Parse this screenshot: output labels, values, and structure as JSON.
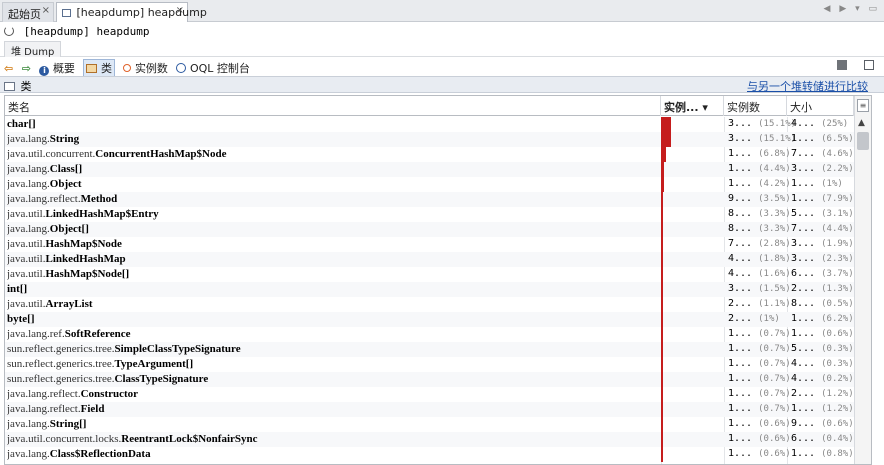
{
  "tabs": [
    {
      "label": "起始页",
      "close": "×"
    },
    {
      "label": "[heapdump] heapdump",
      "close": "×"
    }
  ],
  "nav_arrows": "◀ ▶ ▾ ▭",
  "title": "[heapdump] heapdump",
  "subtab": "堆 Dump",
  "toolbar": {
    "back": "⇦",
    "forward": "⇨",
    "summary": "概要",
    "classes": "类",
    "instances": "实例数",
    "oql": "OQL 控制台"
  },
  "section": {
    "title": "类",
    "compare_link": "与另一个堆转储进行比较"
  },
  "columns": {
    "name": "类名",
    "instances_bar": "实例... ▾",
    "instances": "实例数",
    "size": "大小"
  },
  "colors": {
    "bar": "#c51d1d",
    "link": "#1a4fa8",
    "section_bg": "#e8ecf2"
  },
  "rows": [
    {
      "pkg": "",
      "cls": "char[]",
      "bar_pct": 15.1,
      "count": "3...",
      "count_pct": "(15.1%)",
      "size": "4...",
      "size_pct": "(25%)"
    },
    {
      "pkg": "java.lang.",
      "cls": "String",
      "bar_pct": 15.1,
      "count": "3...",
      "count_pct": "(15.1%)",
      "size": "1...",
      "size_pct": "(6.5%)"
    },
    {
      "pkg": "java.util.concurrent.",
      "cls": "ConcurrentHashMap$Node",
      "bar_pct": 6.8,
      "count": "1...",
      "count_pct": "(6.8%)",
      "size": "7...",
      "size_pct": "(4.6%)"
    },
    {
      "pkg": "java.lang.",
      "cls": "Class[]",
      "bar_pct": 4.4,
      "count": "1...",
      "count_pct": "(4.4%)",
      "size": "3...",
      "size_pct": "(2.2%)"
    },
    {
      "pkg": "java.lang.",
      "cls": "Object",
      "bar_pct": 4.2,
      "count": "1...",
      "count_pct": "(4.2%)",
      "size": "1...",
      "size_pct": "(1%)"
    },
    {
      "pkg": "java.lang.reflect.",
      "cls": "Method",
      "bar_pct": 3.5,
      "count": "9...",
      "count_pct": "(3.5%)",
      "size": "1...",
      "size_pct": "(7.9%)"
    },
    {
      "pkg": "java.util.",
      "cls": "LinkedHashMap$Entry",
      "bar_pct": 3.3,
      "count": "8...",
      "count_pct": "(3.3%)",
      "size": "5...",
      "size_pct": "(3.1%)"
    },
    {
      "pkg": "java.lang.",
      "cls": "Object[]",
      "bar_pct": 3.3,
      "count": "8...",
      "count_pct": "(3.3%)",
      "size": "7...",
      "size_pct": "(4.4%)"
    },
    {
      "pkg": "java.util.",
      "cls": "HashMap$Node",
      "bar_pct": 2.8,
      "count": "7...",
      "count_pct": "(2.8%)",
      "size": "3...",
      "size_pct": "(1.9%)"
    },
    {
      "pkg": "java.util.",
      "cls": "LinkedHashMap",
      "bar_pct": 1.8,
      "count": "4...",
      "count_pct": "(1.8%)",
      "size": "3...",
      "size_pct": "(2.3%)"
    },
    {
      "pkg": "java.util.",
      "cls": "HashMap$Node[]",
      "bar_pct": 1.6,
      "count": "4...",
      "count_pct": "(1.6%)",
      "size": "6...",
      "size_pct": "(3.7%)"
    },
    {
      "pkg": "",
      "cls": "int[]",
      "bar_pct": 1.5,
      "count": "3...",
      "count_pct": "(1.5%)",
      "size": "2...",
      "size_pct": "(1.3%)"
    },
    {
      "pkg": "java.util.",
      "cls": "ArrayList",
      "bar_pct": 1.1,
      "count": "2...",
      "count_pct": "(1.1%)",
      "size": "8...",
      "size_pct": "(0.5%)"
    },
    {
      "pkg": "",
      "cls": "byte[]",
      "bar_pct": 1.0,
      "count": "2...",
      "count_pct": "(1%)",
      "size": "1...",
      "size_pct": "(6.2%)"
    },
    {
      "pkg": "java.lang.ref.",
      "cls": "SoftReference",
      "bar_pct": 0.7,
      "count": "1...",
      "count_pct": "(0.7%)",
      "size": "1...",
      "size_pct": "(0.6%)"
    },
    {
      "pkg": "sun.reflect.generics.tree.",
      "cls": "SimpleClassTypeSignature",
      "bar_pct": 0.7,
      "count": "1...",
      "count_pct": "(0.7%)",
      "size": "5...",
      "size_pct": "(0.3%)"
    },
    {
      "pkg": "sun.reflect.generics.tree.",
      "cls": "TypeArgument[]",
      "bar_pct": 0.7,
      "count": "1...",
      "count_pct": "(0.7%)",
      "size": "4...",
      "size_pct": "(0.3%)"
    },
    {
      "pkg": "sun.reflect.generics.tree.",
      "cls": "ClassTypeSignature",
      "bar_pct": 0.7,
      "count": "1...",
      "count_pct": "(0.7%)",
      "size": "4...",
      "size_pct": "(0.2%)"
    },
    {
      "pkg": "java.lang.reflect.",
      "cls": "Constructor",
      "bar_pct": 0.7,
      "count": "1...",
      "count_pct": "(0.7%)",
      "size": "2...",
      "size_pct": "(1.2%)"
    },
    {
      "pkg": "java.lang.reflect.",
      "cls": "Field",
      "bar_pct": 0.7,
      "count": "1...",
      "count_pct": "(0.7%)",
      "size": "1...",
      "size_pct": "(1.2%)"
    },
    {
      "pkg": "java.lang.",
      "cls": "String[]",
      "bar_pct": 0.6,
      "count": "1...",
      "count_pct": "(0.6%)",
      "size": "9...",
      "size_pct": "(0.6%)"
    },
    {
      "pkg": "java.util.concurrent.locks.",
      "cls": "ReentrantLock$NonfairSync",
      "bar_pct": 0.6,
      "count": "1...",
      "count_pct": "(0.6%)",
      "size": "6...",
      "size_pct": "(0.4%)"
    },
    {
      "pkg": "java.lang.",
      "cls": "Class$ReflectionData",
      "bar_pct": 0.6,
      "count": "1...",
      "count_pct": "(0.6%)",
      "size": "1...",
      "size_pct": "(0.8%)"
    }
  ]
}
